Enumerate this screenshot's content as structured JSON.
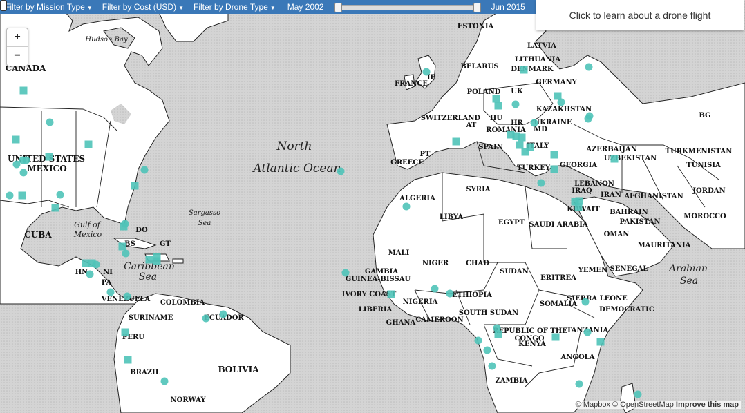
{
  "toolbar": {
    "filter_mission": "Filter by Mission Type",
    "filter_cost": "Filter by Cost (USD)",
    "filter_drone": "Filter by Drone Type",
    "date_start": "May 2002",
    "date_end": "Jun 2015",
    "slider_start_fraction": 0.0,
    "slider_end_fraction": 1.0
  },
  "info_panel": {
    "text": "Click to learn about a drone flight"
  },
  "zoom": {
    "in": "+",
    "out": "−"
  },
  "attribution": {
    "mapbox": "© Mapbox",
    "osm": "© OpenStreetMap",
    "improve": "Improve this map"
  },
  "colors": {
    "marker": "#4fc3b8",
    "toolbar": "#3a78b8",
    "land": "#ffffff",
    "water": "#d8d8d8"
  },
  "map_labels": {
    "countries": [
      "CANADA",
      "UNITED STATES",
      "MEXICO",
      "CUBA",
      "BS",
      "DO",
      "GT",
      "HN",
      "NI",
      "PA",
      "VENEZUELA",
      "COLOMBIA",
      "SURINAME",
      "ECUADOR",
      "PERU",
      "BRAZIL",
      "BOLIVIA",
      "NORWAY",
      "ESTONIA",
      "LATVIA",
      "LITHUANIA",
      "DENMARK",
      "BELARUS",
      "GERMANY",
      "POLAND",
      "UK",
      "IE",
      "FRANCE",
      "SWITZERLAND",
      "AT",
      "HU",
      "HR",
      "ROMANIA",
      "MD",
      "UKRAINE",
      "KAZAKHSTAN",
      "BG",
      "ITALY",
      "SPAIN",
      "PT",
      "GREECE",
      "TURKEY",
      "GEORGIA",
      "AZERBAIJAN",
      "UZBEKISTAN",
      "TURKMENISTAN",
      "TUNISIA",
      "SYRIA",
      "LEBANON",
      "IRAQ",
      "IRAN",
      "AFGHANISTAN",
      "JORDAN",
      "KUWAIT",
      "BAHRAIN",
      "PAKISTAN",
      "MOROCCO",
      "ALGERIA",
      "LIBYA",
      "EGYPT",
      "SAUDI ARABIA",
      "OMAN",
      "MAURITANIA",
      "MALI",
      "NIGER",
      "CHAD",
      "SUDAN",
      "ERITREA",
      "YEMEN",
      "SENEGAL",
      "GAMBIA",
      "GUINEA-BISSAU",
      "IVORY COAST",
      "NIGERIA",
      "ETHIOPIA",
      "SIERRA LEONE",
      "LIBERIA",
      "GHANA",
      "CAMEROON",
      "SOUTH SUDAN",
      "SOMALIA",
      "DEMOCRATIC",
      "REPUBLIC OF THE",
      "CONGO",
      "KENYA",
      "TANZANIA",
      "ANGOLA",
      "ZAMBIA"
    ],
    "seas": [
      "Hudson Bay",
      "North",
      "Atlantic Ocean",
      "Sargasso",
      "Sea",
      "Gulf of",
      "Mexico",
      "Caribbean",
      "Sea",
      "Arabian",
      "Sea"
    ]
  },
  "markers": {
    "circle_count": 38,
    "square_count": 37
  }
}
